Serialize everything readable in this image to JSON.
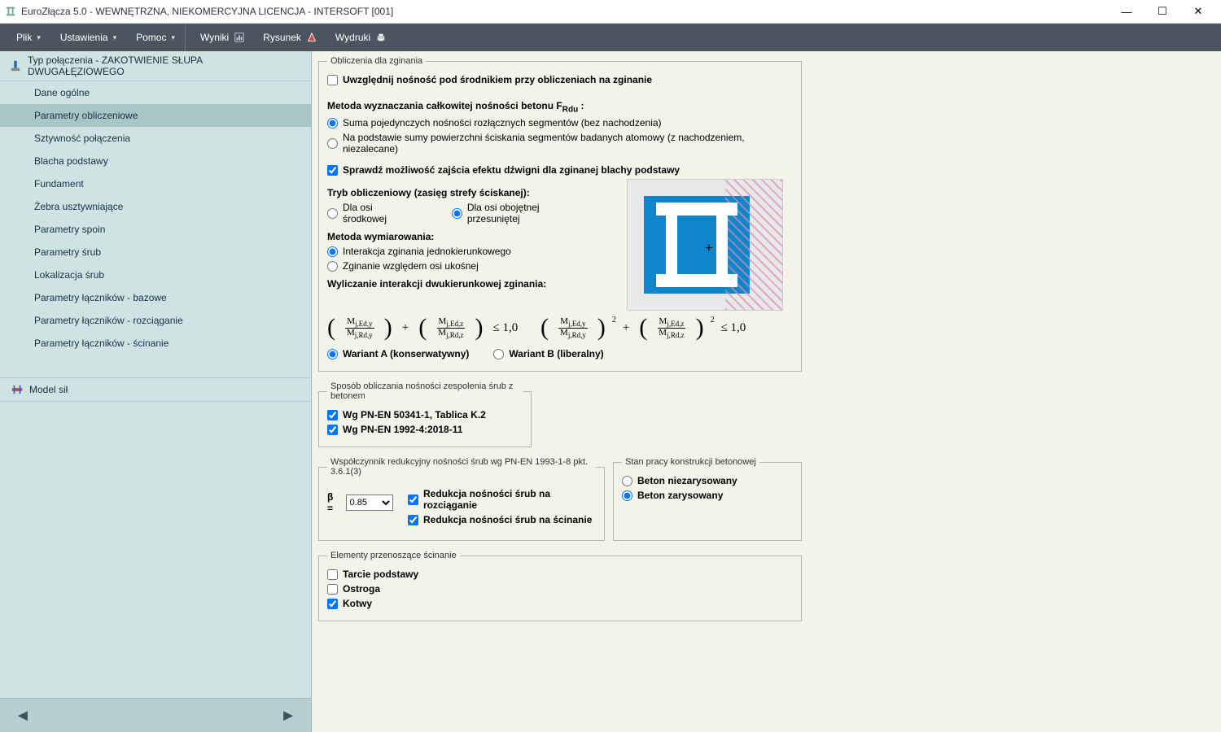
{
  "window": {
    "title": "EuroZłącza 5.0 - WEWNĘTRZNA, NIEKOMERCYJNA LICENCJA - INTERSOFT [001]"
  },
  "menu": {
    "file": "Plik",
    "settings": "Ustawienia",
    "help": "Pomoc"
  },
  "toolbar": {
    "results": "Wyniki",
    "drawing": "Rysunek",
    "printouts": "Wydruki"
  },
  "sidebar": {
    "header": "Typ połączenia - ZAKOTWIENIE SŁUPA DWUGAŁĘZIOWEGO",
    "items": [
      "Dane ogólne",
      "Parametry obliczeniowe",
      "Sztywność połączenia",
      "Blacha podstawy",
      "Fundament",
      "Żebra usztywniające",
      "Parametry spoin",
      "Parametry śrub",
      "Lokalizacja śrub",
      "Parametry łączników - bazowe",
      "Parametry łączników - rozciąganie",
      "Parametry łączników - ścinanie"
    ],
    "selected_index": 1,
    "model": "Model sił"
  },
  "form": {
    "group_bending": "Obliczenia dla zginania",
    "chk_srodnik": "Uwzględnij nośność pod środnikiem przy obliczeniach na zginanie",
    "lbl_method_frdu": "Metoda wyznaczania całkowitej nośności betonu F",
    "lbl_method_frdu_sub": "Rdu",
    "radio_sum": "Suma pojedynczych nośności rozłącznych segmentów (bez nachodzenia)",
    "radio_surface": "Na podstawie sumy powierzchni ściskania segmentów badanych atomowy (z nachodzeniem, niezalecane)",
    "chk_lever": "Sprawdź możliwość zajścia efektu dźwigni dla zginanej blachy podstawy",
    "lbl_mode": "Tryb obliczeniowy (zasięg strefy ściskanej):",
    "radio_center": "Dla osi środkowej",
    "radio_shifted": "Dla osi obojętnej przesuniętej",
    "lbl_dim_method": "Metoda wymiarowania:",
    "radio_uni": "Interakcja zginania jednokierunkowego",
    "radio_oblique": "Zginanie względem osi ukośnej",
    "lbl_biaxial": "Wyliczanie interakcji dwukierunkowej zginania:",
    "radio_varA": "Wariant A (konserwatywny)",
    "radio_varB": "Wariant B (liberalny)",
    "group_bolt_concrete": "Sposób obliczania nośności zespolenia śrub z betonem",
    "chk_50341": "Wg PN-EN 50341-1, Tablica K.2",
    "chk_1992": "Wg PN-EN 1992-4:2018-11",
    "group_beta": "Współczynnik redukcyjny nośności śrub wg PN-EN 1993-1-8 pkt. 3.6.1(3)",
    "beta_label": "β  =",
    "beta_value": "0.85",
    "chk_red_tension": "Redukcja nośności śrub na rozciąganie",
    "chk_red_shear": "Redukcja nośności śrub na ścinanie",
    "group_concrete_state": "Stan pracy konstrukcji betonowej",
    "radio_uncracked": "Beton niezarysowany",
    "radio_cracked": "Beton zarysowany",
    "group_shear_elem": "Elementy przenoszące ścinanie",
    "chk_friction": "Tarcie podstawy",
    "chk_spur": "Ostroga",
    "chk_anchors": "Kotwy"
  },
  "formula": {
    "m_jedy": "M",
    "sub_jedy": "j,Ed,y",
    "m_jrdy": "M",
    "sub_jrdy": "j,Rd,y",
    "m_jedz": "M",
    "sub_jedz": "j,Ed,z",
    "m_jrdz": "M",
    "sub_jrdz": "j,Rd,z",
    "le": "≤ 1,0",
    "plus": "+",
    "sq": "2"
  }
}
